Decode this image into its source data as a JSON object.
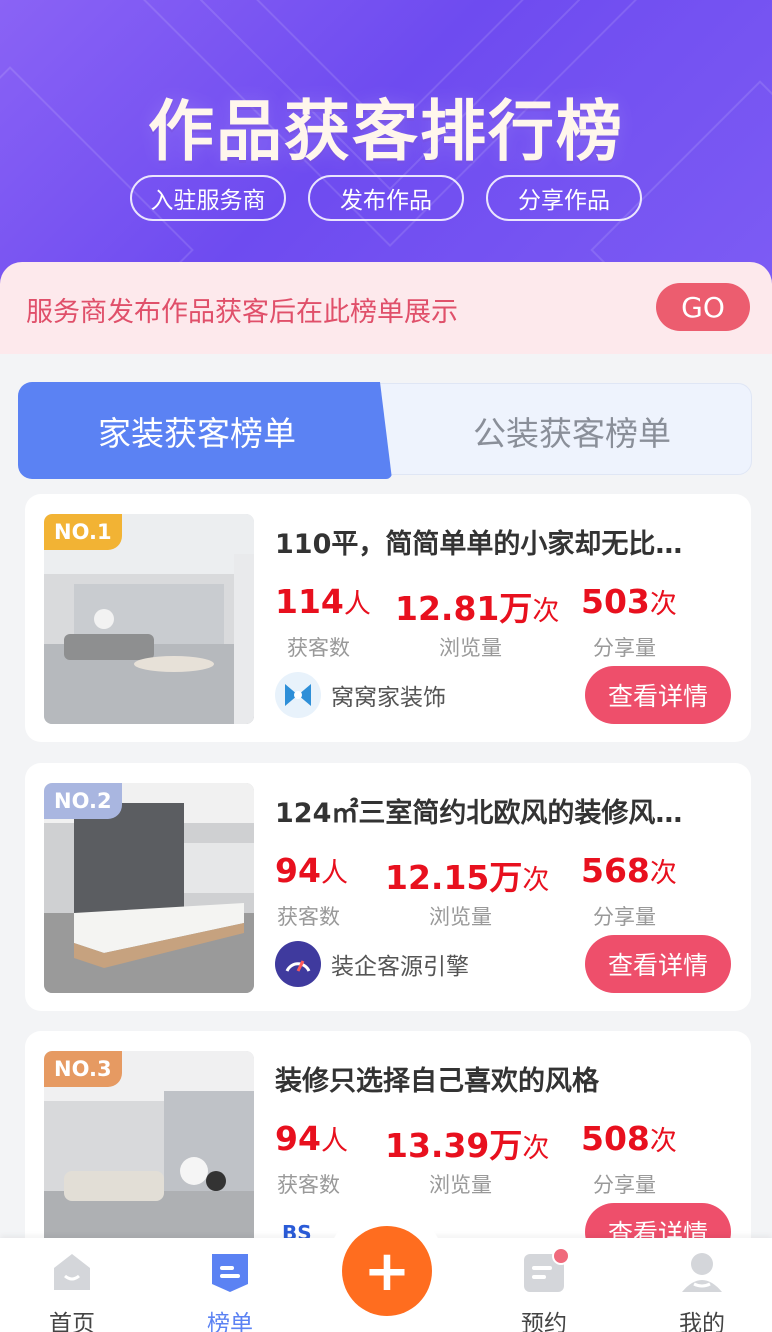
{
  "hero": {
    "title": "作品获客排行榜",
    "pills": [
      "入驻服务商",
      "发布作品",
      "分享作品"
    ]
  },
  "notice": {
    "text": "服务商发布作品获客后在此榜单展示",
    "go_label": "GO"
  },
  "tabs": [
    {
      "label": "家装获客榜单",
      "active": true
    },
    {
      "label": "公装获客榜单",
      "active": false
    }
  ],
  "cards": [
    {
      "rank": "NO.1",
      "title": "110平，简简单单的小家却无比…",
      "leads": "114",
      "leads_unit": "人",
      "views": "12.81万",
      "views_unit": "次",
      "shares": "503",
      "shares_unit": "次",
      "label_leads": "获客数",
      "label_views": "浏览量",
      "label_shares": "分享量",
      "brand": "窝窝家装饰",
      "button": "查看详情"
    },
    {
      "rank": "NO.2",
      "title": "124㎡三室简约北欧风的装修风…",
      "leads": "94",
      "leads_unit": "人",
      "views": "12.15万",
      "views_unit": "次",
      "shares": "568",
      "shares_unit": "次",
      "label_leads": "获客数",
      "label_views": "浏览量",
      "label_shares": "分享量",
      "brand": "装企客源引擎",
      "button": "查看详情"
    },
    {
      "rank": "NO.3",
      "title": "装修只选择自己喜欢的风格",
      "leads": "94",
      "leads_unit": "人",
      "views": "13.39万",
      "views_unit": "次",
      "shares": "508",
      "shares_unit": "次",
      "label_leads": "获客数",
      "label_views": "浏览量",
      "label_shares": "分享量",
      "brand": "",
      "button": "查看详情"
    }
  ],
  "nav": {
    "home": "首页",
    "rank": "榜单",
    "book": "预约",
    "mine": "我的",
    "fab": "+"
  },
  "colors": {
    "accent": "#5b82f3",
    "highlight": "#e8101e",
    "button": "#ee4f6b",
    "fab": "#ff6d1f"
  }
}
